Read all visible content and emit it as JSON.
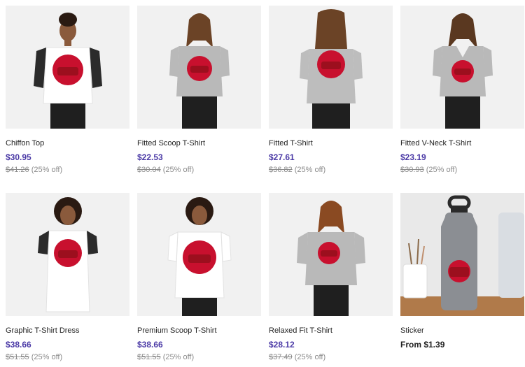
{
  "products": [
    {
      "title": "Chiffon Top",
      "price": "$30.95",
      "original": "$41.26",
      "discount": "(25% off)"
    },
    {
      "title": "Fitted Scoop T-Shirt",
      "price": "$22.53",
      "original": "$30.04",
      "discount": "(25% off)"
    },
    {
      "title": "Fitted T-Shirt",
      "price": "$27.61",
      "original": "$36.82",
      "discount": "(25% off)"
    },
    {
      "title": "Fitted V-Neck T-Shirt",
      "price": "$23.19",
      "original": "$30.93",
      "discount": "(25% off)"
    },
    {
      "title": "Graphic T-Shirt Dress",
      "price": "$38.66",
      "original": "$51.55",
      "discount": "(25% off)"
    },
    {
      "title": "Premium Scoop T-Shirt",
      "price": "$38.66",
      "original": "$51.55",
      "discount": "(25% off)"
    },
    {
      "title": "Relaxed Fit T-Shirt",
      "price": "$28.12",
      "original": "$37.49",
      "discount": "(25% off)"
    },
    {
      "title": "Sticker",
      "price": "From $1.39"
    }
  ],
  "colors": {
    "price": "#4b3aa6",
    "sun_red": "#c8102e",
    "tile_bg": "#f2f2f2"
  }
}
